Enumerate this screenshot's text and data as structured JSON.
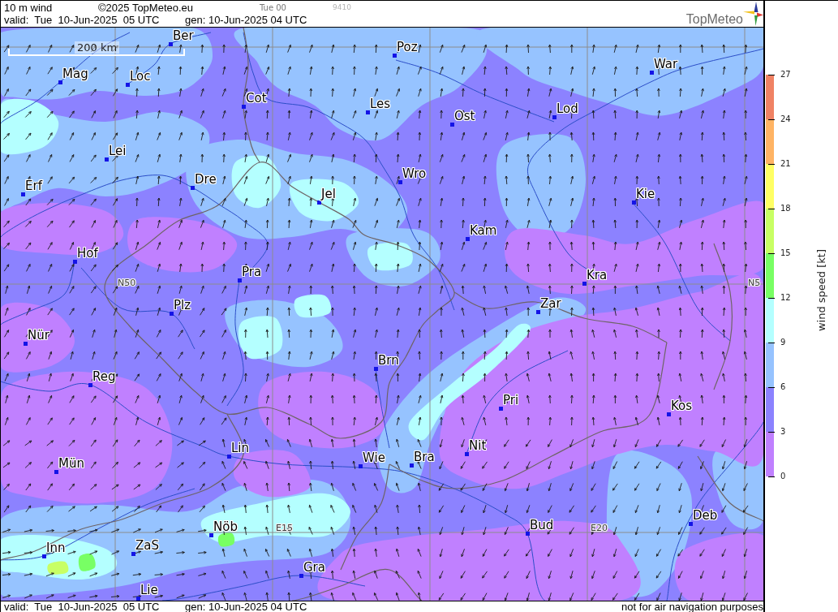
{
  "header": {
    "title": "10 m wind",
    "copyright": "©2025 TopMeteo.eu",
    "run": "Tue 00",
    "code": "9410",
    "valid": "valid:  Tue  10-Jun-2025  05 UTC",
    "generated": "gen: 10-Jun-2025 04 UTC",
    "logo": "TopMeteo"
  },
  "map": {
    "scale_label": "200 km",
    "grid_labels": [
      "N50",
      "N5",
      "E15",
      "E20"
    ],
    "cities": [
      "Ber",
      "Poz",
      "War",
      "Mag",
      "Loc",
      "Cot",
      "Les",
      "Ost",
      "Lod",
      "Lei",
      "Dre",
      "Wro",
      "Jel",
      "Erf",
      "Kie",
      "Kam",
      "Hof",
      "Pra",
      "Kra",
      "Zar",
      "Plz",
      "Nür",
      "Brn",
      "Reg",
      "Pri",
      "Kos",
      "Lin",
      "Nit",
      "Bra",
      "Wie",
      "Mün",
      "Bud",
      "Deb",
      "Nöb",
      "ZaS",
      "Inn",
      "Gra",
      "Lie"
    ]
  },
  "legend": {
    "title": "wind speed [kt]",
    "ticks": [
      "27",
      "24",
      "21",
      "18",
      "15",
      "12",
      "9",
      "6",
      "3",
      "0"
    ],
    "bands": [
      {
        "color": "#f08264"
      },
      {
        "color": "#ffb464"
      },
      {
        "color": "#ffff64"
      },
      {
        "color": "#c8ff64"
      },
      {
        "color": "#78ff64"
      },
      {
        "color": "#b4ffff"
      },
      {
        "color": "#96c3ff"
      },
      {
        "color": "#8c82ff"
      },
      {
        "color": "#c080ff"
      }
    ]
  },
  "footer": {
    "valid": "valid:  Tue  10-Jun-2025  05 UTC",
    "generated": "gen: 10-Jun-2025 04 UTC",
    "disclaimer": "not for air navigation purposes"
  }
}
